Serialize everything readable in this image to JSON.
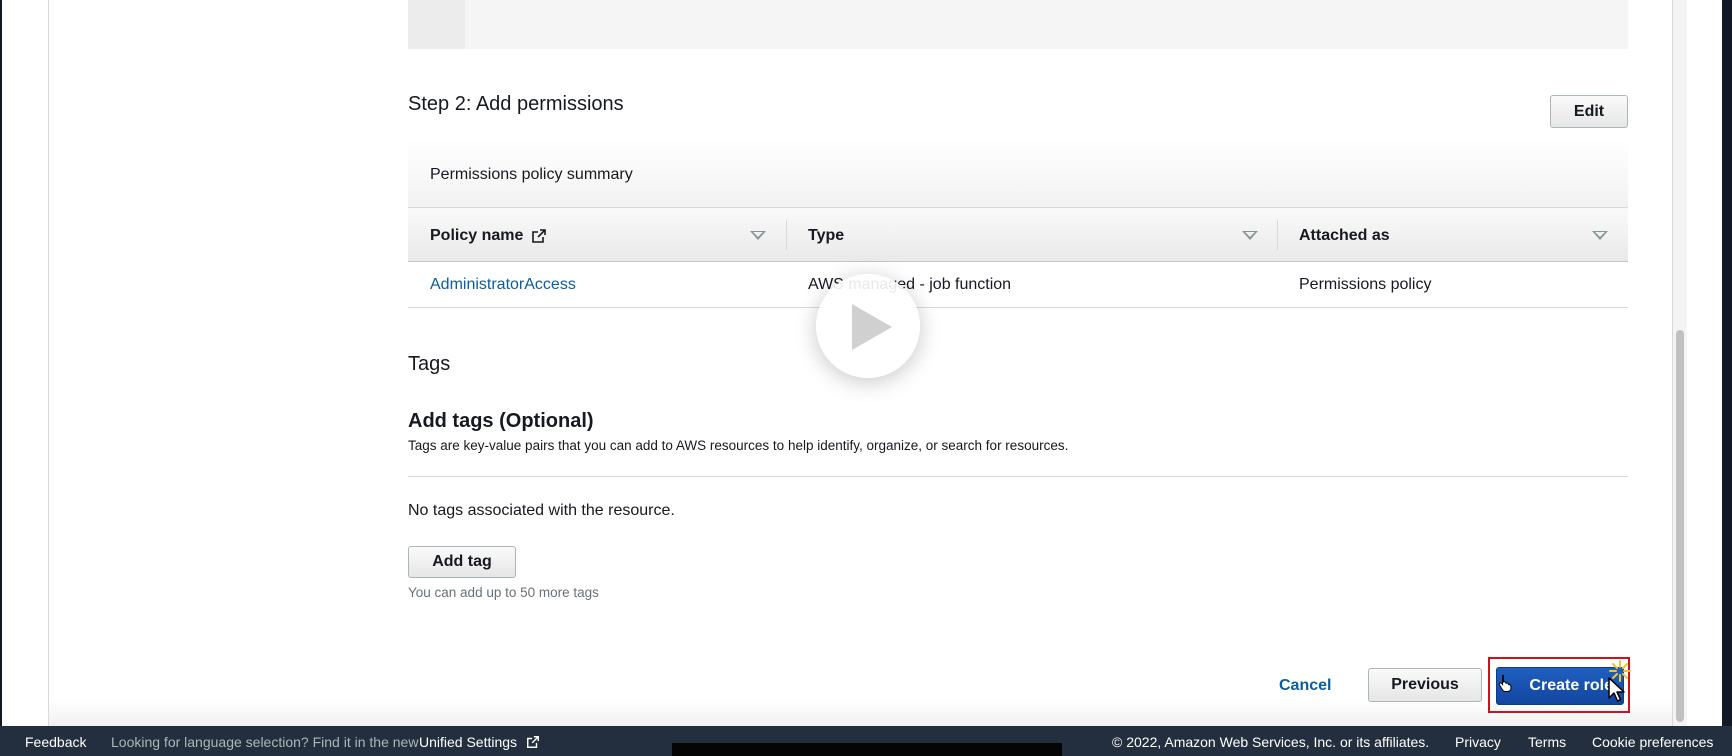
{
  "step2": {
    "title": "Step 2: Add permissions",
    "edit_label": "Edit",
    "summary_title": "Permissions policy summary",
    "columns": [
      "Policy name",
      "Type",
      "Attached as"
    ],
    "rows": [
      {
        "policy_name": "AdministratorAccess",
        "type": "AWS managed - job function",
        "attached_as": "Permissions policy"
      }
    ]
  },
  "tags": {
    "section_title": "Tags",
    "add_title": "Add tags (Optional)",
    "description": "Tags are key-value pairs that you can add to AWS resources to help identify, organize, or search for resources.",
    "empty_text": "No tags associated with the resource.",
    "add_tag_label": "Add tag",
    "hint": "You can add up to 50 more tags"
  },
  "actions": {
    "cancel": "Cancel",
    "previous": "Previous",
    "create": "Create role"
  },
  "footer": {
    "feedback": "Feedback",
    "language_prompt": "Looking for language selection? Find it in the new",
    "unified_settings": "Unified Settings",
    "copyright": "© 2022, Amazon Web Services, Inc. or its affiliates.",
    "privacy": "Privacy",
    "terms": "Terms",
    "cookie": "Cookie preferences"
  },
  "colors": {
    "link": "#0b5d9e",
    "primary_button": "#1f5fc2",
    "footer_bg": "#232f3e",
    "highlight_border": "#d0101b"
  },
  "icons": [
    "external-link-icon",
    "sort-caret-icon",
    "play-icon",
    "hand-cursor-icon",
    "pointer-cursor-icon"
  ]
}
